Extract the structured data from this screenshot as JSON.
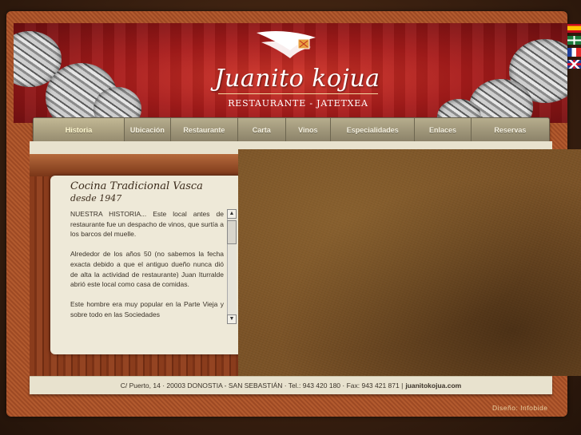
{
  "header": {
    "title": "Juanito kojua",
    "subtitle": "RESTAURANTE - JATETXEA",
    "logo_icon": "boat-sail-logo-icon",
    "rope_icon": "rope-decoration-icon"
  },
  "languages": [
    {
      "name": "spanish-flag-icon"
    },
    {
      "name": "basque-flag-icon"
    },
    {
      "name": "french-flag-icon"
    },
    {
      "name": "uk-flag-icon"
    }
  ],
  "nav": {
    "items": [
      {
        "label": "Historia",
        "active": true
      },
      {
        "label": "Ubicación"
      },
      {
        "label": "Restaurante"
      },
      {
        "label": "Carta"
      },
      {
        "label": "Vinos"
      },
      {
        "label": "Especialidades"
      },
      {
        "label": "Enlaces"
      },
      {
        "label": "Reservas"
      }
    ]
  },
  "main": {
    "heading": "Cocina Tradicional Vasca",
    "subheading": "desde 1947",
    "paragraphs": [
      "NUESTRA HISTORIA... Este local antes de restaurante fue un despacho de vinos, que surtía a los barcos del muelle.",
      "Alrededor de los años 50 (no sabemos la fecha exacta debido a que el antiguo dueño nunca dió de alta la actividad de restaurante) Juan Iturralde abrió este local como casa de comidas.",
      "Este hombre era muy popular en la Parte Vieja y sobre todo en las Sociedades"
    ],
    "scroll_up": "▲",
    "scroll_down": "▼"
  },
  "footer": {
    "address": "C/ Puerto, 14 · 20003 DONOSTIA - SAN SEBASTIÁN · Tel.: 943 420 180 · Fax: 943 421 871 |",
    "email": "juanitokojua.com"
  },
  "credit": "Diseño: Infobide",
  "colors": {
    "header_red": "#a91c1b",
    "nav": "#a39a7c",
    "content_bg": "#e8e2ce",
    "frame": "#b25a2e"
  }
}
